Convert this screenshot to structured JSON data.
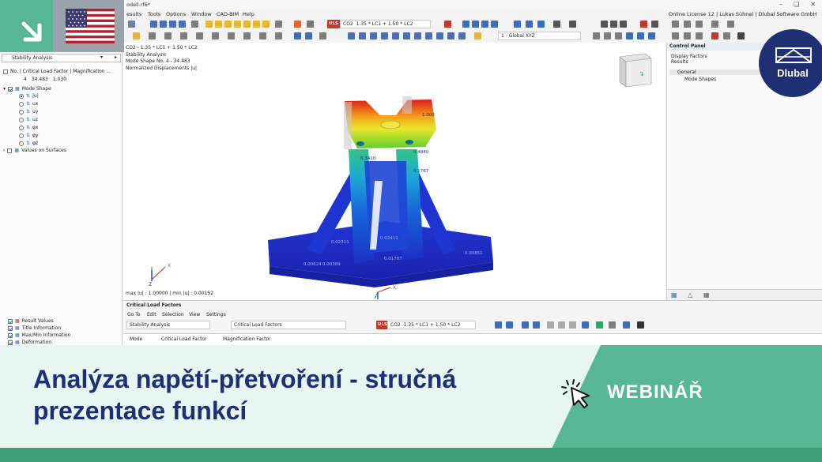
{
  "window": {
    "doc_title": "odell.rf6*",
    "license": "Online License 12 | Lukas Sühnel | Dlubal Software GmbH",
    "controls": [
      "–",
      "❏",
      "✕"
    ]
  },
  "menu": {
    "items": [
      "esults",
      "Tools",
      "Options",
      "Window",
      "CAD-BIM",
      "Help"
    ]
  },
  "toolbar": {
    "uls_badge": "ULS",
    "combination_code": "CO2",
    "combination_formula": "1.35 * LC1 + 1.50 * LC2",
    "coordinate_system": "1 - Global XYZ"
  },
  "navigator": {
    "header": "Stability Analysis",
    "column_header": "No. | Critical Load Factor | Magnification ...",
    "selected_row": {
      "no": "4",
      "factor": "34.483",
      "magnification": "1.030"
    },
    "mode_shape_label": "Mode Shape",
    "mode_options": [
      "|u|",
      "ux",
      "uy",
      "uz",
      "φx",
      "φy",
      "φz"
    ],
    "values_on_surfaces": "Values on Surfaces",
    "bottom_items": [
      "Result Values",
      "Title Information",
      "Max/Min Information",
      "Deformation"
    ]
  },
  "viewport": {
    "info_lines": [
      "CO2 - 1.35 * LC1 + 1.50 * LC2",
      "Stability Analysis",
      "Mode Shape No. 4 - 34.483",
      "Normalized Displacements |u|"
    ],
    "footer": "max |u| : 1.00000 | min |u| : 0.00152",
    "value_labels": [
      "1.000",
      "0.4840",
      "0.3410",
      "0.1767",
      "0.02311",
      "0.02411",
      "0.01787",
      "0.00851",
      "0.00624",
      "0.00389"
    ],
    "axis_x": "X",
    "axis_z": "Z"
  },
  "control_panel": {
    "title": "Control Panel",
    "lines": [
      "Display Factors",
      "Results"
    ],
    "group": "General",
    "group_item": "Mode Shapes"
  },
  "table_panel": {
    "title": "Critical Load Factors",
    "menu": [
      "Go To",
      "Edit",
      "Selection",
      "View",
      "Settings"
    ],
    "combo_analysis": "Stability Analysis",
    "combo_table": "Critical Load Factors",
    "uls_badge": "ULS",
    "combination_code": "CO2",
    "combination_formula": "1.35 * LC1 + 1.50 * LC2",
    "col_headers": [
      "Mode",
      "Critical Load Factor",
      "Magnification Factor"
    ]
  },
  "branding": {
    "logo_text": "Dlubal"
  },
  "banner": {
    "title_line1": "Analýza napětí-přetvoření - stručná",
    "title_line2": "prezentace funkcí",
    "tag": "WEBINÁŘ"
  },
  "colors": {
    "brand_navy": "#1f2f73",
    "brand_green": "#56b695",
    "banner_bg": "#e8f6f1"
  }
}
